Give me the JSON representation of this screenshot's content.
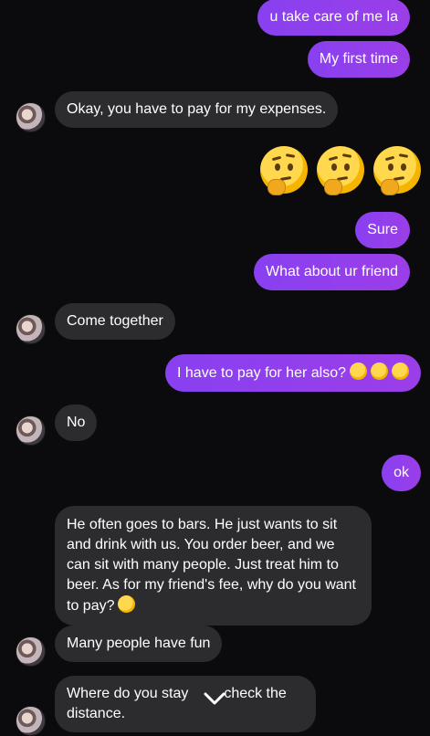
{
  "messages": {
    "m1": "u take care of me la",
    "m2": "My first time",
    "m3": "Okay, you have to pay for my expenses.",
    "m4": "Sure",
    "m5": "What about ur friend",
    "m6": "Come together",
    "m7": "I have to pay for her also?",
    "m8": "No",
    "m9": "ok",
    "m10": "He often goes to bars. He just wants to sit and drink with us. You order beer, and we can sit with many people. Just treat him to beer. As for my friend's fee, why do you want to pay?",
    "m11": "Many people have fun",
    "m12_a": "Where do you stay",
    "m12_b": "check the distance."
  },
  "emojis": {
    "thinking": "thinking-face-emoji",
    "laughing": "rolling-on-floor-laughing-emoji"
  },
  "colors": {
    "background": "#0b0b0d",
    "outgoing_bubble": "#8a3ef2",
    "incoming_bubble": "#2c2c2e",
    "text": "#ffffff"
  }
}
